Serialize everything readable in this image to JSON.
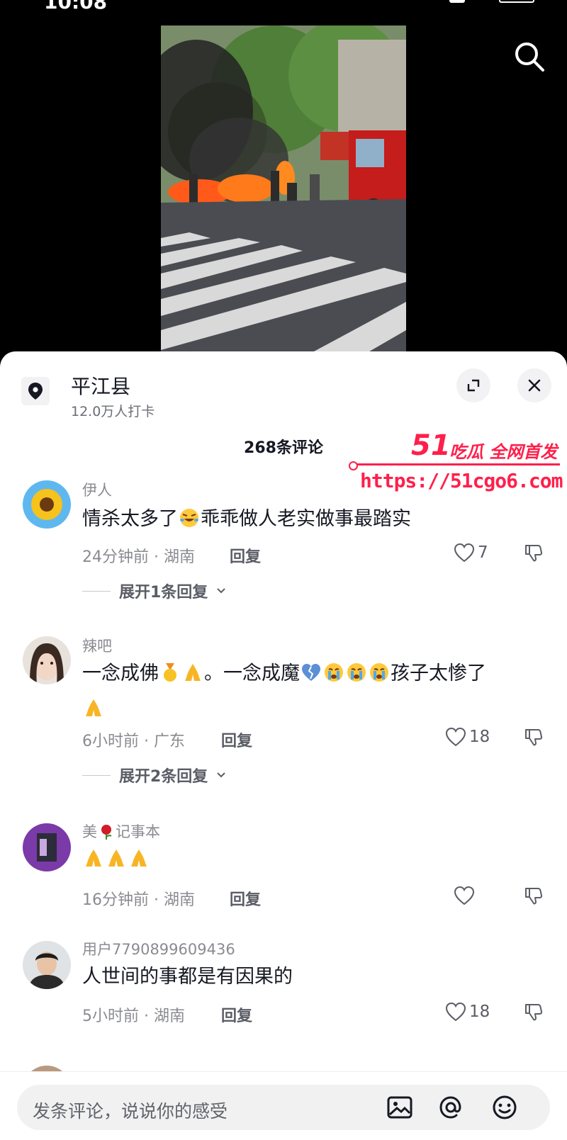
{
  "status": {
    "time": "10:08"
  },
  "location": {
    "title": "平江县",
    "subtitle": "12.0万人打卡"
  },
  "comments_header": {
    "count_label": "268条评论"
  },
  "watermark": {
    "brand": "51",
    "slogan": "吃瓜 全网首发",
    "url": "https://51cgo6.com"
  },
  "comments": [
    {
      "name": "伊人",
      "text_parts": [
        "情杀太多了",
        "乖乖做人老实做事最踏实"
      ],
      "time_location": "24分钟前 · 湖南",
      "reply_label": "回复",
      "likes": "7",
      "expand_label": "展开1条回复"
    },
    {
      "name": "辣吧",
      "text_parts": [
        "一念成佛",
        "。一念成魔",
        "孩子太惨了"
      ],
      "time_location": "6小时前 · 广东",
      "reply_label": "回复",
      "likes": "18",
      "expand_label": "展开2条回复"
    },
    {
      "name_parts": [
        "美",
        "记事本"
      ],
      "time_location": "16分钟前 · 湖南",
      "reply_label": "回复",
      "likes": ""
    },
    {
      "name": "用户7790899609436",
      "text": "人世间的事都是有因果的",
      "time_location": "5小时前 · 湖南",
      "reply_label": "回复",
      "likes": "18"
    }
  ],
  "input": {
    "placeholder": "发条评论，说说你的感受"
  },
  "colors": {
    "accent": "#ff1f4b",
    "text": "#161823",
    "muted": "#8a8b91"
  }
}
